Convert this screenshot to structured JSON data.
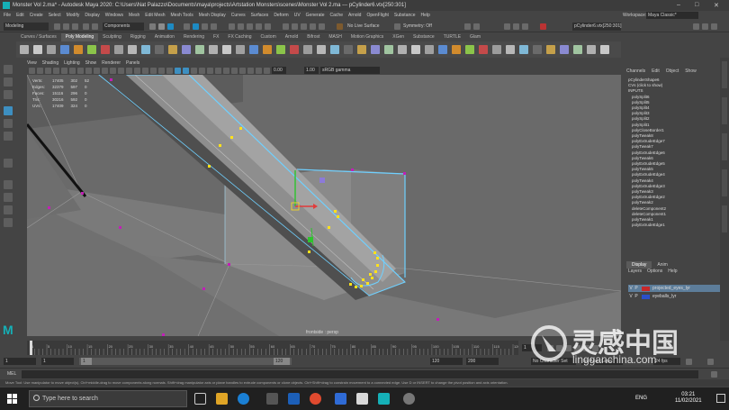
{
  "window": {
    "title": "Monster Vol 2.ma* - Autodesk Maya 2020: C:\\Users\\Nat Palazzo\\Documents\\maya\\projects\\Artstation Monsters\\scenes\\Monster Vol 2.ma  ---  pCylinder6.vtx[250:301]"
  },
  "menubar": {
    "items": [
      "File",
      "Edit",
      "Create",
      "Select",
      "Modify",
      "Display",
      "Windows",
      "Mesh",
      "Edit Mesh",
      "Mesh Tools",
      "Mesh Display",
      "Curves",
      "Surfaces",
      "Deform",
      "UV",
      "Generate",
      "Cache",
      "Arnold",
      "OpenFlight",
      "Substance",
      "Help"
    ],
    "workspace_label": "Workspace:",
    "workspace_value": "Maya Classic*"
  },
  "statusline": {
    "mode": "Modeling",
    "component_mode": "Components",
    "no_live_surface": "No Live Surface",
    "symmetry": "Symmetry: Off",
    "selection_field": "pCylinder6.vtx[250:301]"
  },
  "shelf": {
    "tabs": [
      "Curves / Surfaces",
      "Poly Modeling",
      "Sculpting",
      "Rigging",
      "Animation",
      "Rendering",
      "FX",
      "FX Caching",
      "Custom",
      "Arnold",
      "Bifrost",
      "MASH",
      "Motion Graphics",
      "XGen",
      "Substance",
      "TURTLE",
      "Glam"
    ],
    "active_tab": "Poly Modeling"
  },
  "panel": {
    "menus": [
      "View",
      "Shading",
      "Lighting",
      "Show",
      "Renderer",
      "Panels"
    ],
    "field_a": "0.00",
    "field_b": "1.00",
    "colorspace": "sRGB gamma"
  },
  "hud": {
    "rows": [
      {
        "label": "Verts:",
        "a": "17405",
        "b": "302",
        "c": "52"
      },
      {
        "label": "Edges:",
        "a": "32379",
        "b": "597",
        "c": "0"
      },
      {
        "label": "Faces:",
        "a": "15116",
        "b": "296",
        "c": "0"
      },
      {
        "label": "Tris:",
        "a": "30216",
        "b": "592",
        "c": "0"
      },
      {
        "label": "UVs:",
        "a": "17409",
        "b": "324",
        "c": "0"
      }
    ]
  },
  "viewport_label": "frontside : persp",
  "channelbox": {
    "menus": [
      "Channels",
      "Edit",
      "Object",
      "Show"
    ],
    "items": [
      "pCylinderShape6",
      "CVs (click to show)",
      "INPUTS",
      "polySplit6",
      "polySplit5",
      "polySplit4",
      "polySplit3",
      "polySplit2",
      "polySplit1",
      "polyCloseBorder1",
      "polyTweak8",
      "polyExtrudeEdge7",
      "polyTweak7",
      "polyExtrudeEdge6",
      "polyTweak6",
      "polyExtrudeEdge5",
      "polyTweak5",
      "polyExtrudeEdge4",
      "polyTweak4",
      "polyExtrudeEdge3",
      "polyTweak3",
      "polyExtrudeEdge2",
      "polyTweak2",
      "deleteComponent2",
      "deleteComponent1",
      "polyTweak1",
      "polyExtrudeEdge1"
    ]
  },
  "layers": {
    "tabs": [
      "Display",
      "Anim"
    ],
    "menus": [
      "Layers",
      "Options",
      "Help"
    ],
    "rows": [
      {
        "v": "V",
        "p": "P",
        "name": "projected_eyes_lyr",
        "color": "#c8282a",
        "selected": true
      },
      {
        "v": "V",
        "p": "P",
        "name": "eyeballs_lyr",
        "color": "#2b4fc8",
        "selected": false
      }
    ]
  },
  "timeline": {
    "ticks": [
      "1",
      "5",
      "10",
      "15",
      "20",
      "25",
      "30",
      "35",
      "40",
      "45",
      "50",
      "55",
      "60",
      "65",
      "70",
      "75",
      "80",
      "85",
      "90",
      "95",
      "100",
      "105",
      "110",
      "115",
      "120"
    ],
    "current_frame": "1",
    "range_start": "1",
    "range_inner_start": "1",
    "range_handle": "1",
    "range_inner_end": "120",
    "range_end": "120",
    "range_end2": "200",
    "no_character": "No Character Set",
    "no_anim_layer": "No Anim Layer",
    "fps": "24 fps"
  },
  "cmdline": {
    "label": "MEL"
  },
  "helpline": "Move Tool: Use manipulator to move object(s). Ctrl+middle-drag to move components along normals. Shift+drag manipulator axis or plane handles to extrude components or clone objects. Ctrl+Shift+drag to constrain movement to a connected edge. Use D or INSERT to change the pivot position and axis orientation.",
  "taskbar": {
    "search_placeholder": "Type here to search",
    "lang": "ENG",
    "time": "03:21",
    "date": "11/02/2021"
  },
  "watermark": {
    "cn_text": "灵感中国",
    "url": "lingganchina.com"
  },
  "colors": {
    "accent": "#15b0b7",
    "selection_highlight": "#5fd6ff",
    "selected_vertex": "#ffe21a",
    "vertex": "#c21fb7"
  }
}
